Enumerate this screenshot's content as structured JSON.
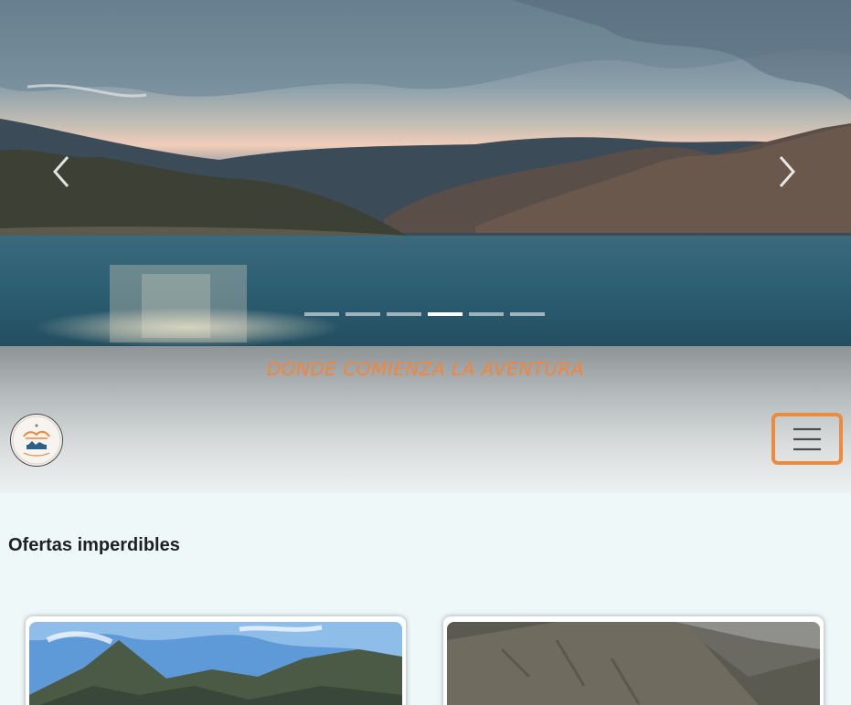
{
  "hero": {
    "prev_icon": "chevron-left-icon",
    "next_icon": "chevron-right-icon",
    "slide_count": 6,
    "active_slide": 4
  },
  "tagline": "DONDE COMIENZA LA AVENTURA",
  "header": {
    "logo_icon": "brand-logo",
    "menu_icon": "hamburger-menu-icon",
    "accent_color": "#ec8a3d"
  },
  "offers": {
    "title": "Ofertas imperdibles"
  }
}
